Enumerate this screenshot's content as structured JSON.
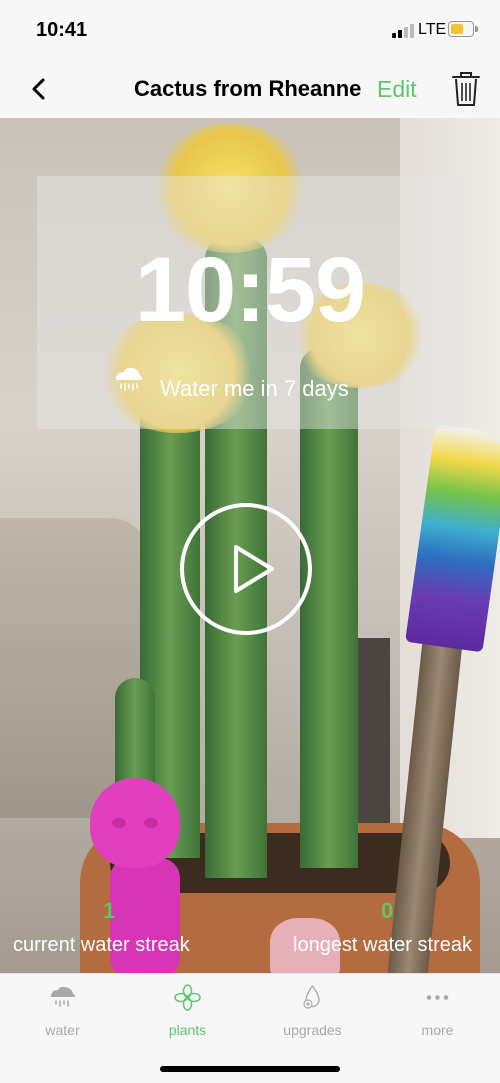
{
  "colors": {
    "accent": "#5cc66b",
    "inactive": "#a9a9a9",
    "battery": "#f1c232"
  },
  "status_bar": {
    "time": "10:41",
    "network": "LTE"
  },
  "nav": {
    "title": "Cactus from Rheanne",
    "edit_label": "Edit"
  },
  "hero": {
    "timer": "10:59",
    "water_message": "Water me in 7 days"
  },
  "streaks": {
    "current_value": "1",
    "current_label": "current water streak",
    "longest_value": "0",
    "longest_label": "longest water streak"
  },
  "tabs": [
    {
      "label": "water",
      "icon": "rain-cloud-icon",
      "active": false
    },
    {
      "label": "plants",
      "icon": "clover-icon",
      "active": true
    },
    {
      "label": "upgrades",
      "icon": "droplet-plus-icon",
      "active": false
    },
    {
      "label": "more",
      "icon": "ellipsis-icon",
      "active": false
    }
  ]
}
